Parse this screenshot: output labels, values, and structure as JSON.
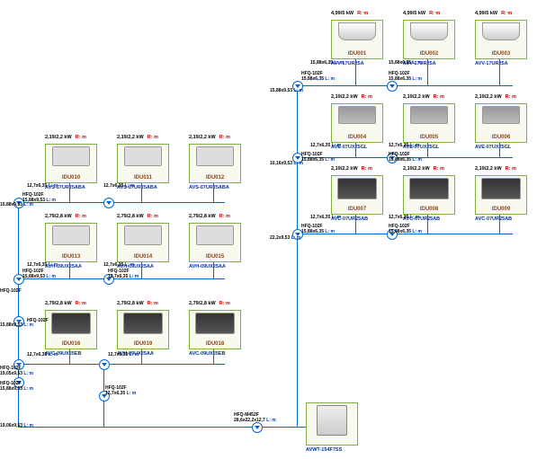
{
  "units": {
    "idu001": {
      "id": "IDU001",
      "model": "AVV-17UR25A",
      "power": "4,99/5 kW",
      "rm": "R: m"
    },
    "idu002": {
      "id": "IDU002",
      "model": "AVV-17UR25A",
      "power": "4,99/5 kW",
      "rm": "R: m"
    },
    "idu003": {
      "id": "IDU003",
      "model": "AVV-17UR25A",
      "power": "4,99/5 kW",
      "rm": "R: m"
    },
    "idu004": {
      "id": "IDU004",
      "model": "AVE-07UX25GL",
      "power": "2,19/2,2 kW",
      "rm": "R: m"
    },
    "idu005": {
      "id": "IDU005",
      "model": "AVE-07UX25GL",
      "power": "2,19/2,2 kW",
      "rm": "R: m"
    },
    "idu006": {
      "id": "IDU006",
      "model": "AVE-07UX25GL",
      "power": "2,19/2,2 kW",
      "rm": "R: m"
    },
    "idu007": {
      "id": "IDU007",
      "model": "AVC-07UR25AB",
      "power": "2,19/2,2 kW",
      "rm": "R: m"
    },
    "idu008": {
      "id": "IDU008",
      "model": "AVC-07UR25AB",
      "power": "2,19/2,2 kW",
      "rm": "R: m"
    },
    "idu009": {
      "id": "IDU009",
      "model": "AVC-07UR25AB",
      "power": "2,19/2,2 kW",
      "rm": "R: m"
    },
    "idu010": {
      "id": "IDU010",
      "model": "AVS-07UR25ABA",
      "power": "2,19/2,2 kW",
      "rm": "R: m"
    },
    "idu011": {
      "id": "IDU011",
      "model": "AVS-07UR25ABA",
      "power": "2,19/2,2 kW",
      "rm": "R: m"
    },
    "idu012": {
      "id": "IDU012",
      "model": "AVS-07UR25ABA",
      "power": "2,19/2,2 kW",
      "rm": "R: m"
    },
    "idu013": {
      "id": "IDU013",
      "model": "AVH-09UX25AA",
      "power": "2,79/2,8 kW",
      "rm": "R: m"
    },
    "idu014": {
      "id": "IDU014",
      "model": "AVH-09UX25AA",
      "power": "2,79/2,8 kW",
      "rm": "R: m"
    },
    "idu015": {
      "id": "IDU015",
      "model": "AVH-09UX25AA",
      "power": "2,79/2,8 kW",
      "rm": "R: m"
    },
    "idu016": {
      "id": "IDU016",
      "model": "AVC-09UX25EB",
      "power": "2,79/2,8 kW",
      "rm": "R: m"
    },
    "idu018": {
      "id": "IDU018",
      "model": "AVC-09UX25EB",
      "power": "2,79/2,8 kW",
      "rm": "R: m"
    },
    "idu019": {
      "id": "IDU019",
      "model": "AVH-09UX25AA",
      "power": "2,79/2,8 kW",
      "rm": "R: m"
    },
    "outdoor": {
      "id": "",
      "model": "AVWT-154F7SS",
      "power": "",
      "rm": ""
    }
  },
  "pipe_labels": {
    "p1": "15,88x6,35",
    "p2": "15,88x9,53",
    "p3": "12,7x6,35",
    "p4": "HFQ-102F",
    "p5": "19,05x9,53",
    "p6": "19,06x9,53",
    "p7": "22,2x9,53",
    "p8": "10,16x9,53",
    "p9": "HFQ-M452F",
    "p10": "28,6x22,2x12,7",
    "lm": "L: m"
  }
}
